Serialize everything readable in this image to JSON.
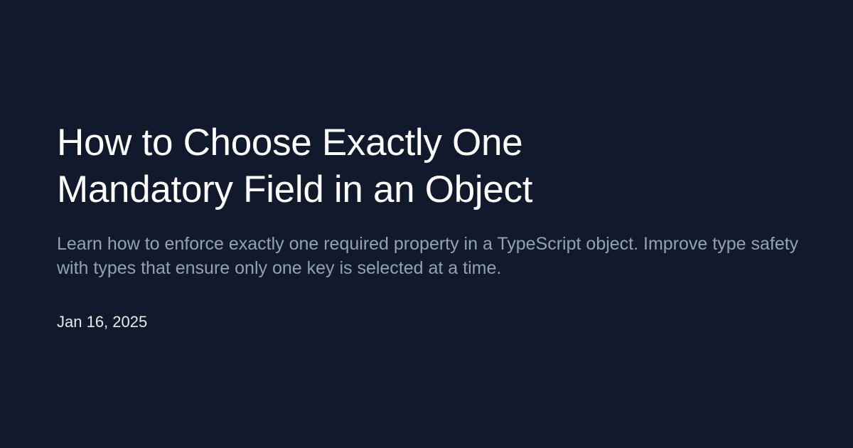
{
  "post": {
    "title": "How to Choose Exactly One Mandatory Field in an Object",
    "description": "Learn how to enforce exactly one required property in a TypeScript object. Improve type safety with types that ensure only one key is selected at a time.",
    "date": "Jan 16, 2025"
  },
  "colors": {
    "background": "#111a2c",
    "title": "#ffffff",
    "description": "#94a0b3",
    "date": "#e4e9f0"
  }
}
